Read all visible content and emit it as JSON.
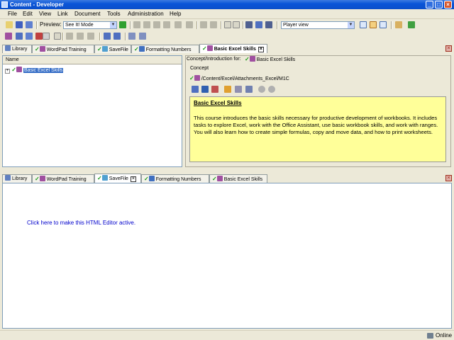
{
  "window": {
    "title": "Content - Developer"
  },
  "menu": [
    "File",
    "Edit",
    "View",
    "Link",
    "Document",
    "Tools",
    "Administration",
    "Help"
  ],
  "toolbar": {
    "preview_label": "Preview:",
    "mode_value": "See It! Mode",
    "view_value": "Player view"
  },
  "tabs": [
    "Library",
    "WordPad Training",
    "SaveFile",
    "Formatting Numbers",
    "Basic Excel Skills"
  ],
  "left_panel": {
    "header": "Name",
    "tree_item": "Basic Excel Skills"
  },
  "right_panel": {
    "header_label": "Concept/Introduction for:",
    "header_doc": "Basic Excel Skills",
    "concept_label": "Concept",
    "path": "/Content/Excel/Attachments_Excel/M1C"
  },
  "concept": {
    "title": "Basic Excel Skills",
    "text": "This course introduces the basic skills necessary for productive development of workbooks. It includes tasks to explore Excel, work with the Office Assistant, use basic workbook skills, and work with ranges. You will also learn how to create simple formulas, copy and move data, and how to print worksheets."
  },
  "editor": {
    "link": "Click here to make this HTML Editor active."
  },
  "status": {
    "text": "Online"
  },
  "colors": {
    "titlebar": "#0a55d8",
    "concept_bg": "#ffff99",
    "link": "#0000cc"
  }
}
